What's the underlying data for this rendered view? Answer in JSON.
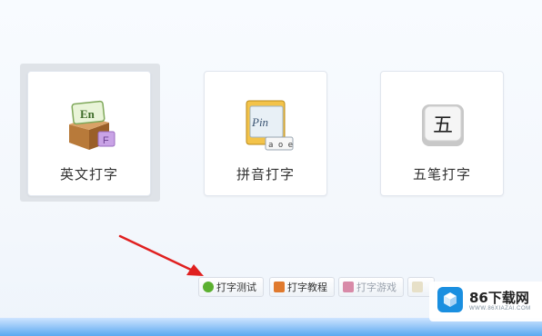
{
  "cards": {
    "english": {
      "label": "英文打字",
      "icon_text": "En"
    },
    "pinyin": {
      "label": "拼音打字",
      "icon_text": "Pin",
      "icon_sub": "a o e"
    },
    "wubi": {
      "label": "五笔打字",
      "icon_text": "五"
    }
  },
  "toolbar": {
    "test_label": "打字测试",
    "tutorial_label": "打字教程",
    "game_label": "打字游戏"
  },
  "watermark": {
    "brand": "86下载网",
    "site": "WWW.86XIAZAI.COM"
  },
  "colors": {
    "accent_blue": "#5aa9f0",
    "arrow_red": "#e02020"
  }
}
